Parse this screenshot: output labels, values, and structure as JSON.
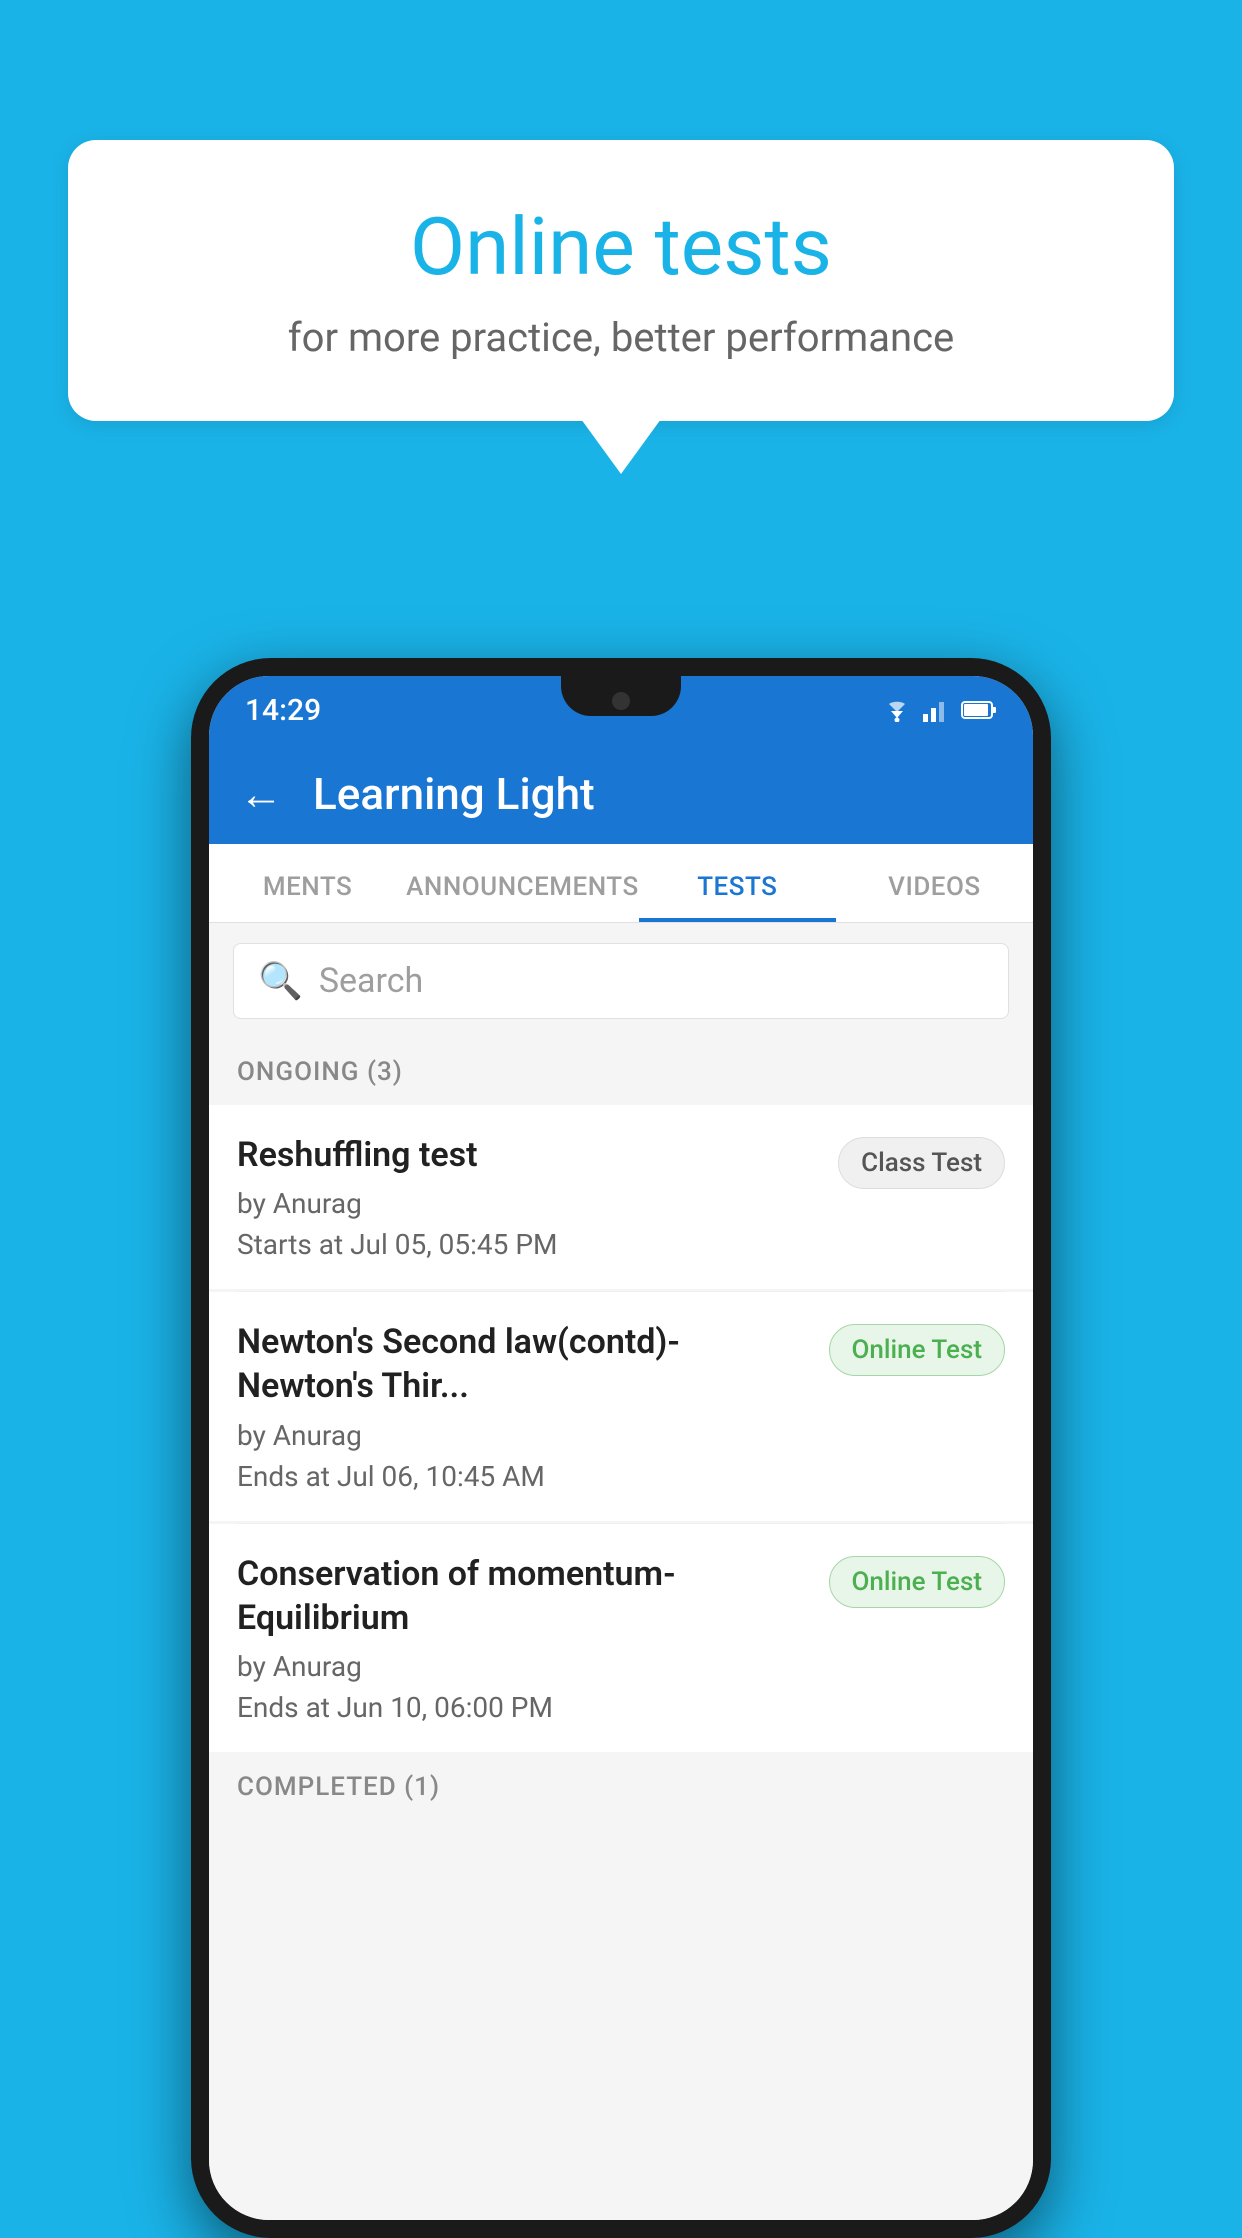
{
  "background_color": "#1ab3e8",
  "speech_bubble": {
    "title": "Online tests",
    "subtitle": "for more practice, better performance"
  },
  "status_bar": {
    "time": "14:29",
    "icons": [
      "wifi",
      "signal",
      "battery"
    ]
  },
  "app_header": {
    "title": "Learning Light",
    "back_label": "←"
  },
  "tabs": [
    {
      "label": "MENTS",
      "active": false
    },
    {
      "label": "ANNOUNCEMENTS",
      "active": false
    },
    {
      "label": "TESTS",
      "active": true
    },
    {
      "label": "VIDEOS",
      "active": false
    }
  ],
  "search": {
    "placeholder": "Search"
  },
  "ongoing_section": {
    "title": "ONGOING (3)"
  },
  "tests": [
    {
      "name": "Reshuffling test",
      "by": "by Anurag",
      "date": "Starts at  Jul 05, 05:45 PM",
      "badge": "Class Test",
      "badge_type": "class"
    },
    {
      "name": "Newton's Second law(contd)-Newton's Thir...",
      "by": "by Anurag",
      "date": "Ends at  Jul 06, 10:45 AM",
      "badge": "Online Test",
      "badge_type": "online"
    },
    {
      "name": "Conservation of momentum-Equilibrium",
      "by": "by Anurag",
      "date": "Ends at  Jun 10, 06:00 PM",
      "badge": "Online Test",
      "badge_type": "online"
    }
  ],
  "completed_section": {
    "title": "COMPLETED (1)"
  }
}
